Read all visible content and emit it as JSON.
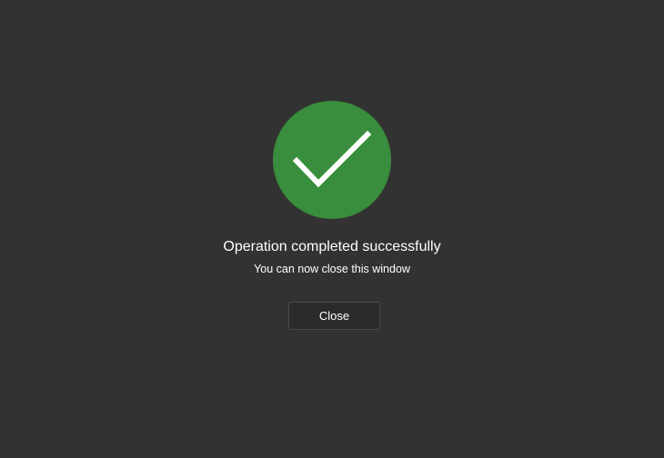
{
  "dialog": {
    "icon": "checkmark-icon",
    "accent_color": "#388e3c",
    "background_color": "#323232",
    "title": "Operation completed successfully",
    "subtitle": "You can now close this window",
    "close_label": "Close"
  }
}
